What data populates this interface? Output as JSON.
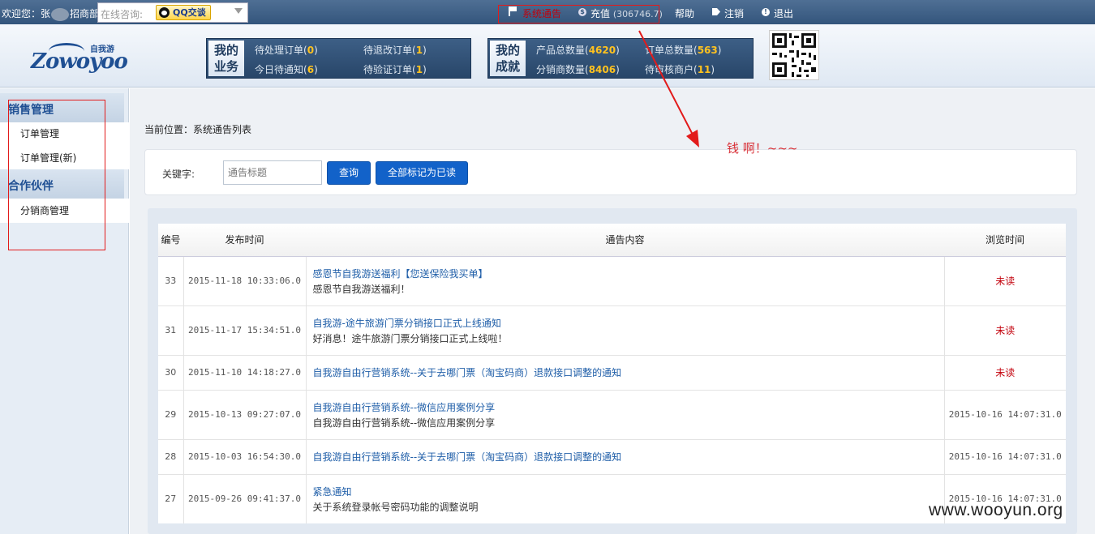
{
  "topbar": {
    "welcome_prefix": "欢迎您：张",
    "welcome_suffix": "招商部",
    "consult_label": "在线咨询:",
    "qq_button": "QQ交谈",
    "notice": "系统通告",
    "recharge_label": "充值",
    "recharge_amount": "(306746.7)",
    "help": "帮助",
    "logout": "注销",
    "exit": "退出"
  },
  "logo": {
    "cn": "自我游",
    "en": "Zowoyoo"
  },
  "business": {
    "label_line1": "我的",
    "label_line2": "业务",
    "items": [
      {
        "label": "待处理订单",
        "count": "0"
      },
      {
        "label": "待退改订单",
        "count": "1"
      },
      {
        "label": "今日待通知",
        "count": "6"
      },
      {
        "label": "待验证订单",
        "count": "1"
      }
    ]
  },
  "achievement": {
    "label_line1": "我的",
    "label_line2": "成就",
    "items": [
      {
        "label": "产品总数量",
        "count": "4620"
      },
      {
        "label": "订单总数量",
        "count": "563"
      },
      {
        "label": "分销商数量",
        "count": "8406"
      },
      {
        "label": "待审核商户",
        "count": "11"
      }
    ]
  },
  "sidebar": {
    "sections": [
      {
        "title": "销售管理",
        "items": [
          "订单管理",
          "订单管理(新)"
        ]
      },
      {
        "title": "合作伙伴",
        "items": [
          "分销商管理"
        ]
      }
    ]
  },
  "breadcrumb": "当前位置：系统通告列表",
  "search": {
    "keyword_label": "关键字:",
    "placeholder": "通告标题",
    "query_button": "查询",
    "mark_all_button": "全部标记为已读"
  },
  "table": {
    "headers": [
      "编号",
      "发布时间",
      "通告内容",
      "浏览时间"
    ],
    "rows": [
      {
        "id": "33",
        "time": "2015-11-18 10:33:06.0",
        "title": "感恩节自我游送福利【您送保险我买单】",
        "summary": "感恩节自我游送福利！",
        "view": "未读",
        "unread": true
      },
      {
        "id": "31",
        "time": "2015-11-17 15:34:51.0",
        "title": "自我游-途牛旅游门票分销接口正式上线通知",
        "summary": "好消息！途牛旅游门票分销接口正式上线啦！",
        "view": "未读",
        "unread": true
      },
      {
        "id": "30",
        "time": "2015-11-10 14:18:27.0",
        "title": "自我游自由行营销系统--关于去哪门票（淘宝码商）退款接口调整的通知",
        "summary": "",
        "view": "未读",
        "unread": true
      },
      {
        "id": "29",
        "time": "2015-10-13 09:27:07.0",
        "title": "自我游自由行营销系统--微信应用案例分享",
        "summary": "自我游自由行营销系统--微信应用案例分享",
        "view": "2015-10-16 14:07:31.0",
        "unread": false
      },
      {
        "id": "28",
        "time": "2015-10-03 16:54:30.0",
        "title": "自我游自由行营销系统--关于去哪门票（淘宝码商）退款接口调整的通知",
        "summary": "",
        "view": "2015-10-16 14:07:31.0",
        "unread": false
      },
      {
        "id": "27",
        "time": "2015-09-26 09:41:37.0",
        "title": "紧急通知",
        "summary": "关于系统登录帐号密码功能的调整说明",
        "view": "2015-10-16 14:07:31.0",
        "unread": false
      }
    ]
  },
  "annotation": {
    "text": "钱 啊！~~~"
  },
  "watermark": "www.wooyun.org",
  "colors": {
    "accent": "#1262c9",
    "unread": "#c2000b",
    "highlight_box": "#e21b1b"
  }
}
